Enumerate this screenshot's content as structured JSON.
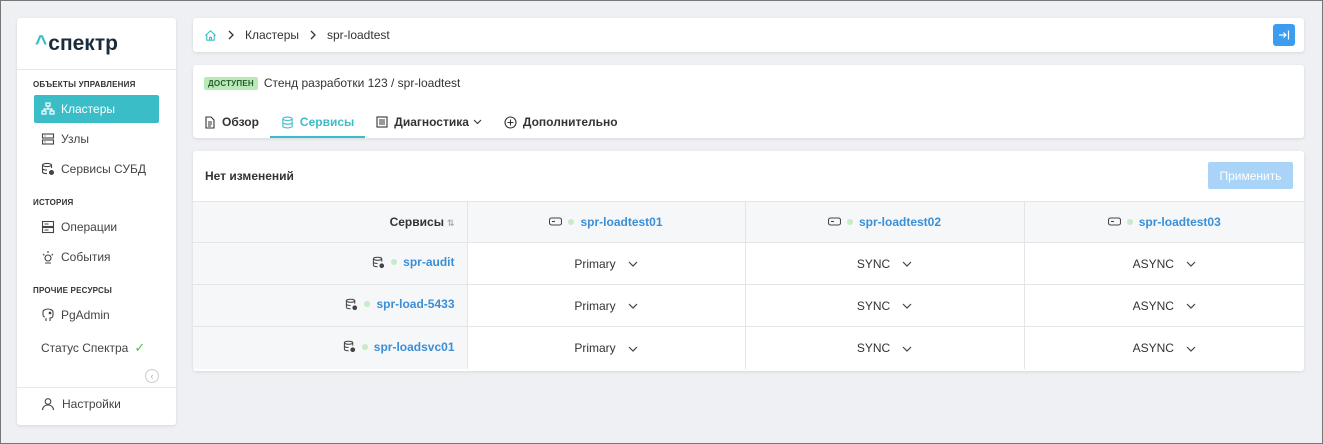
{
  "sidebar": {
    "logo": "спектр",
    "sections": {
      "objects": "ОБЪЕКТЫ УПРАВЛЕНИЯ",
      "history": "ИСТОРИЯ",
      "other": "ПРОЧИЕ РЕСУРСЫ"
    },
    "items": {
      "clusters": "Кластеры",
      "nodes": "Узлы",
      "dbms": "Сервисы СУБД",
      "operations": "Операции",
      "events": "События",
      "pgadmin": "PgAdmin"
    },
    "status": "Статус Спектра",
    "settings": "Настройки"
  },
  "breadcrumb": {
    "items": [
      "Кластеры",
      "spr-loadtest"
    ]
  },
  "header": {
    "badge": "ДОСТУПЕН",
    "title": "Стенд разработки 123 /  spr-loadtest",
    "tabs": [
      "Обзор",
      "Сервисы",
      "Диагностика",
      "Дополнительно"
    ],
    "active_tab": "Сервисы"
  },
  "services": {
    "status_text": "Нет изменений",
    "apply_label": "Применить",
    "column_header": "Сервисы",
    "hosts": [
      "spr-loadtest01",
      "spr-loadtest02",
      "spr-loadtest03"
    ],
    "rows": [
      {
        "name": "spr-audit",
        "roles": [
          "Primary",
          "SYNC",
          "ASYNC"
        ]
      },
      {
        "name": "spr-load-5433",
        "roles": [
          "Primary",
          "SYNC",
          "ASYNC"
        ]
      },
      {
        "name": "spr-loadsvc01",
        "roles": [
          "Primary",
          "SYNC",
          "ASYNC"
        ]
      }
    ]
  },
  "colors": {
    "accent": "#3bbdc8",
    "link": "#3b8fd6",
    "apply_disabled": "#a9d4f7",
    "badge_bg": "#b8eab8"
  }
}
